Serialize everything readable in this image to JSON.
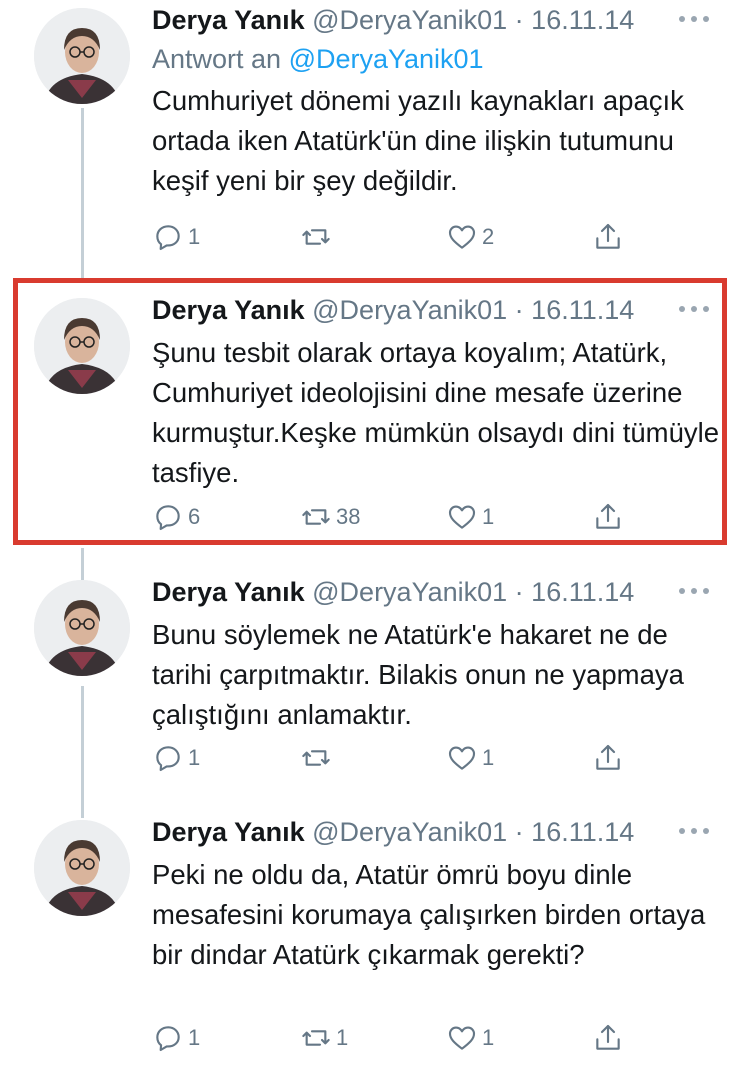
{
  "tweets": [
    {
      "name": "Derya Yanık",
      "handle": "@DeryaYanik01",
      "dot": "·",
      "date": "16.11.14",
      "reply_prefix": "Antwort an ",
      "reply_mention": "@DeryaYanik01",
      "text": "Cumhuriyet dönemi yazılı kaynakları apaçık ortada iken Atatürk'ün dine ilişkin tutumunu keşif yeni bir şey değildir.",
      "replies": "1",
      "retweets": "",
      "likes": "2"
    },
    {
      "name": "Derya Yanık",
      "handle": "@DeryaYanik01",
      "dot": "·",
      "date": "16.11.14",
      "text": "Şunu tesbit olarak ortaya koyalım; Atatürk, Cumhuriyet ideolojisini dine mesafe üzerine kurmuştur.Keşke mümkün olsaydı dini tümüyle tasfiye.",
      "replies": "6",
      "retweets": "38",
      "likes": "1"
    },
    {
      "name": "Derya Yanık",
      "handle": "@DeryaYanik01",
      "dot": "·",
      "date": "16.11.14",
      "text": "Bunu söylemek ne Atatürk'e hakaret ne de tarihi çarpıtmaktır. Bilakis onun ne yapmaya çalıştığını anlamaktır.",
      "replies": "1",
      "retweets": "",
      "likes": "1"
    },
    {
      "name": "Derya Yanık",
      "handle": "@DeryaYanik01",
      "dot": "·",
      "date": "16.11.14",
      "text": "Peki ne oldu da, Atatür ömrü boyu dinle mesafesini korumaya çalışırken birden ortaya bir dindar Atatürk çıkarmak gerekti?",
      "replies": "1",
      "retweets": "1",
      "likes": "1"
    }
  ],
  "colors": {
    "highlight": "#d93b2f",
    "link": "#1da1f2",
    "muted": "#657786",
    "thread_line": "#c4cfd6"
  },
  "icons": [
    "reply-icon",
    "retweet-icon",
    "like-icon",
    "share-icon",
    "more-icon"
  ]
}
